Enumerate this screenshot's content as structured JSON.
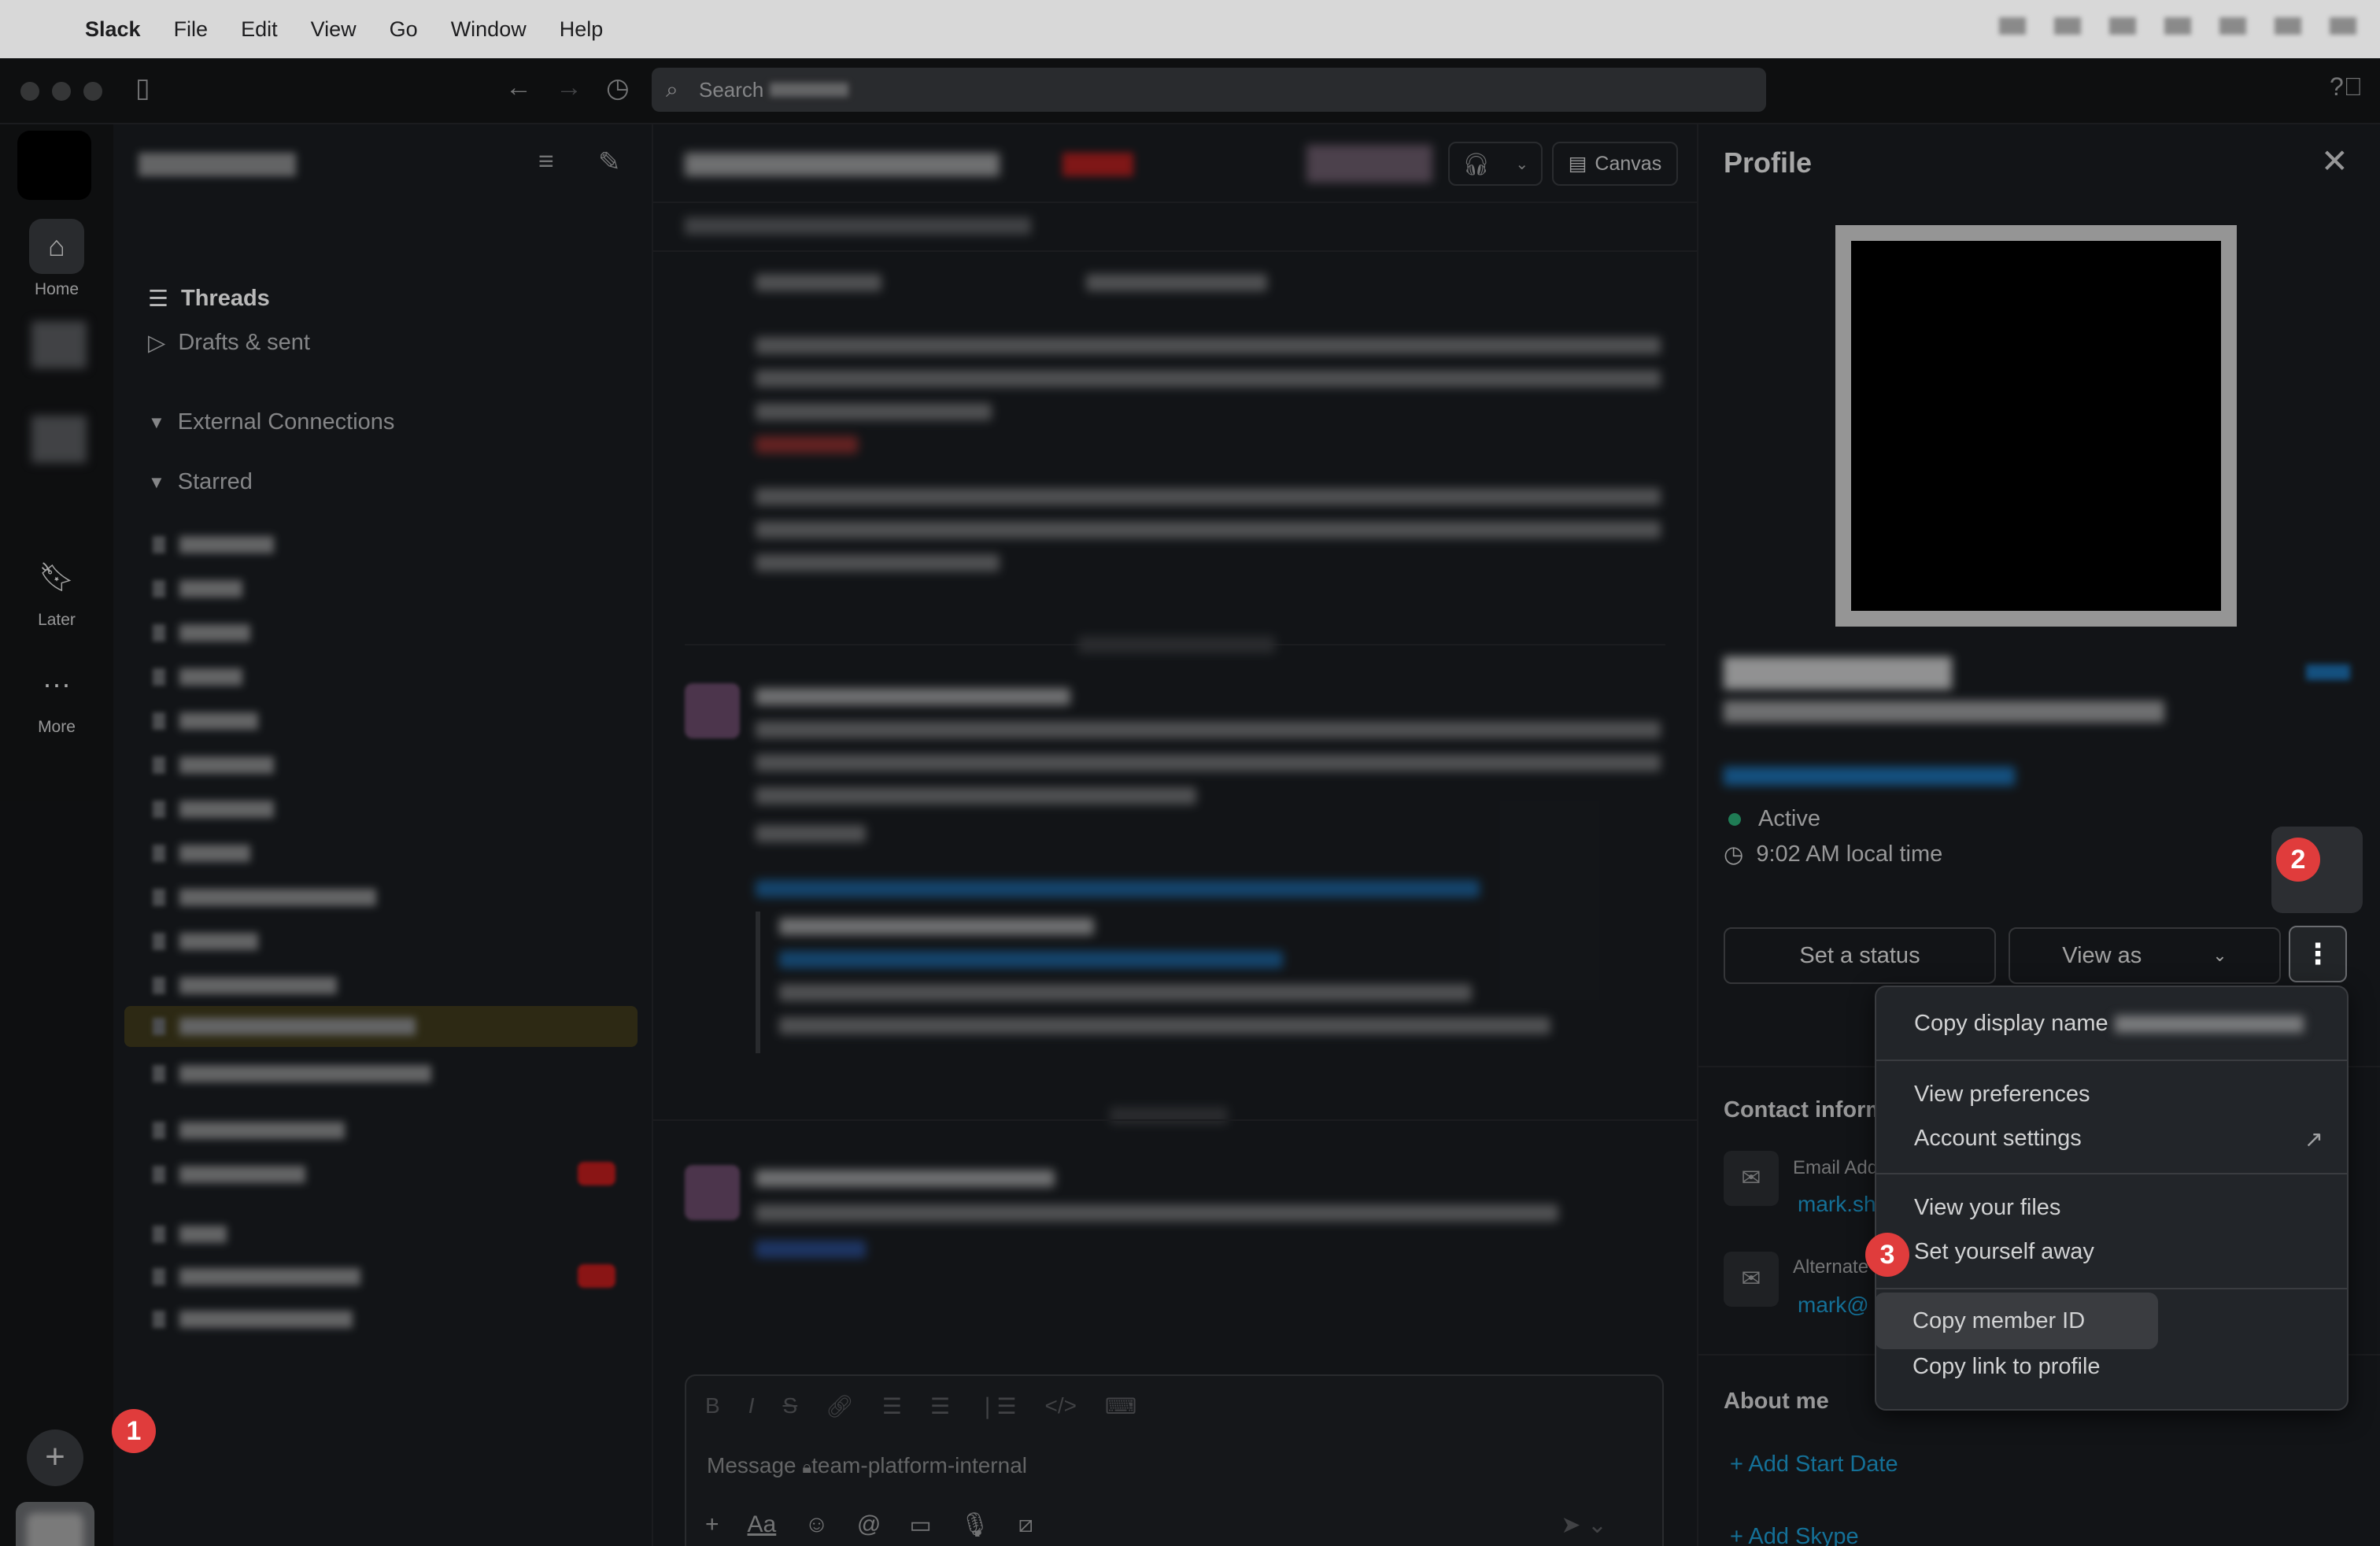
{
  "menubar": {
    "app_name": "Slack",
    "items": [
      "File",
      "Edit",
      "View",
      "Go",
      "Window",
      "Help"
    ]
  },
  "toolbar": {
    "search_placeholder": "Search"
  },
  "rail": {
    "home_label": "Home",
    "later_label": "Later",
    "more_label": "More",
    "add_icon": "plus-icon"
  },
  "sidebar": {
    "threads_label": "Threads",
    "drafts_label": "Drafts & sent",
    "sections": [
      "External Connections",
      "Starred"
    ]
  },
  "channel": {
    "canvas_label": "Canvas",
    "composer_placeholder": "Message",
    "composer_channel": "team-platform-internal"
  },
  "profile": {
    "title": "Profile",
    "status": "Active",
    "local_time": "9:02 AM local time",
    "set_status_label": "Set a status",
    "view_as_label": "View as",
    "contact_heading": "Contact inform",
    "email_label": "Email Add",
    "email_value": "mark.sh",
    "alternate_label": "Alternate",
    "alternate_value": "mark@",
    "about_heading": "About me",
    "add_start_date": "+ Add Start Date",
    "add_skype": "+ Add Skype",
    "status_color": "#2bac76"
  },
  "menu": {
    "copy_display_name": "Copy display name",
    "view_preferences": "View preferences",
    "account_settings": "Account settings",
    "view_files": "View your files",
    "set_away": "Set yourself away",
    "copy_member_id": "Copy member ID",
    "copy_link": "Copy link to profile"
  },
  "markers": [
    "1",
    "2",
    "3"
  ]
}
